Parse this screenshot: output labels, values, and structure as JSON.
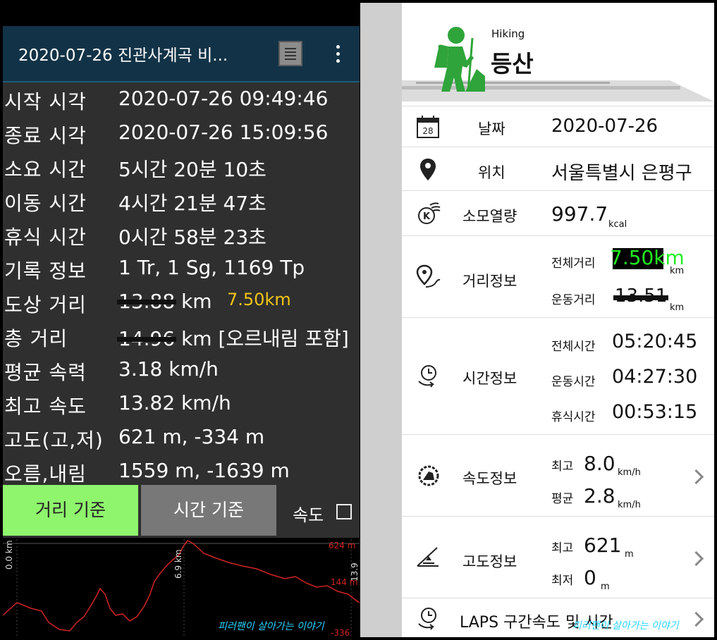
{
  "left": {
    "title": "2020-07-26 진관사계곡 비...",
    "rows": [
      {
        "label": "시작 시각",
        "value": "2020-07-26 09:49:46"
      },
      {
        "label": "종료 시각",
        "value": "2020-07-26 15:09:56"
      },
      {
        "label": "소요 시간",
        "value": "5시간 20분 10초"
      },
      {
        "label": "이동 시간",
        "value": "4시간 21분 47초"
      },
      {
        "label": "휴식 시간",
        "value": "0시간 58분 23초"
      },
      {
        "label": "기록 정보",
        "value": "1 Tr, 1 Sg, 1169 Tp"
      },
      {
        "label": "도상 거리",
        "value": "13.88",
        "unit": " km",
        "annotation": "7.50km"
      },
      {
        "label": "총 거리",
        "value": "14.96",
        "unit": " km [오르내림 포함]"
      },
      {
        "label": "평균 속력",
        "value": "3.18 km/h"
      },
      {
        "label": "최고 속도",
        "value": "13.82 km/h"
      },
      {
        "label": "고도(고,저)",
        "value": "621 m, -334 m"
      },
      {
        "label": "오름,내림",
        "value": "1559 m, -1639 m"
      }
    ],
    "buttons": {
      "distance": "거리 기준",
      "time": "시간 기준",
      "speed": "속도"
    },
    "chart": {
      "x_labels": [
        "0.0 km",
        "6.9 km",
        "13.9 km"
      ],
      "y_labels": [
        "624 m",
        "144 m",
        "-336 m"
      ]
    },
    "watermark": "피러팬이 살아가는 이야기"
  },
  "right": {
    "header": {
      "small": "Hiking",
      "title": "등산"
    },
    "date": {
      "label": "날짜",
      "value": "2020-07-26",
      "icon_num": "28"
    },
    "location": {
      "label": "위치",
      "value": "서울특별시 은평구"
    },
    "calories": {
      "label": "소모열량",
      "value": "997.7",
      "unit": "kcal"
    },
    "distance": {
      "label": "거리정보",
      "total_label": "전체거리",
      "total_value": "7.50km",
      "total_unit": "km",
      "move_label": "운동거리",
      "move_value": "13.51",
      "move_unit": "km"
    },
    "time": {
      "label": "시간정보",
      "total_label": "전체시간",
      "total_value": "05:20:45",
      "move_label": "운동시간",
      "move_value": "04:27:30",
      "rest_label": "휴식시간",
      "rest_value": "00:53:15"
    },
    "speed": {
      "label": "속도정보",
      "max_label": "최고",
      "max_value": "8.0",
      "avg_label": "평균",
      "avg_value": "2.8",
      "unit": "km/h"
    },
    "altitude": {
      "label": "고도정보",
      "max_label": "최고",
      "max_value": "621",
      "max_unit": "m",
      "min_label": "최저",
      "min_value": "0",
      "min_unit": "m"
    },
    "laps": {
      "label": "LAPS 구간속도 및 시간"
    },
    "watermark": "피러팬이 살아가는 이야기"
  },
  "colors": {
    "accent_green": "#2fa43a",
    "highlight_green": "#8ff56d",
    "annotation_yellow": "#f3c514",
    "topbar": "#123347"
  }
}
